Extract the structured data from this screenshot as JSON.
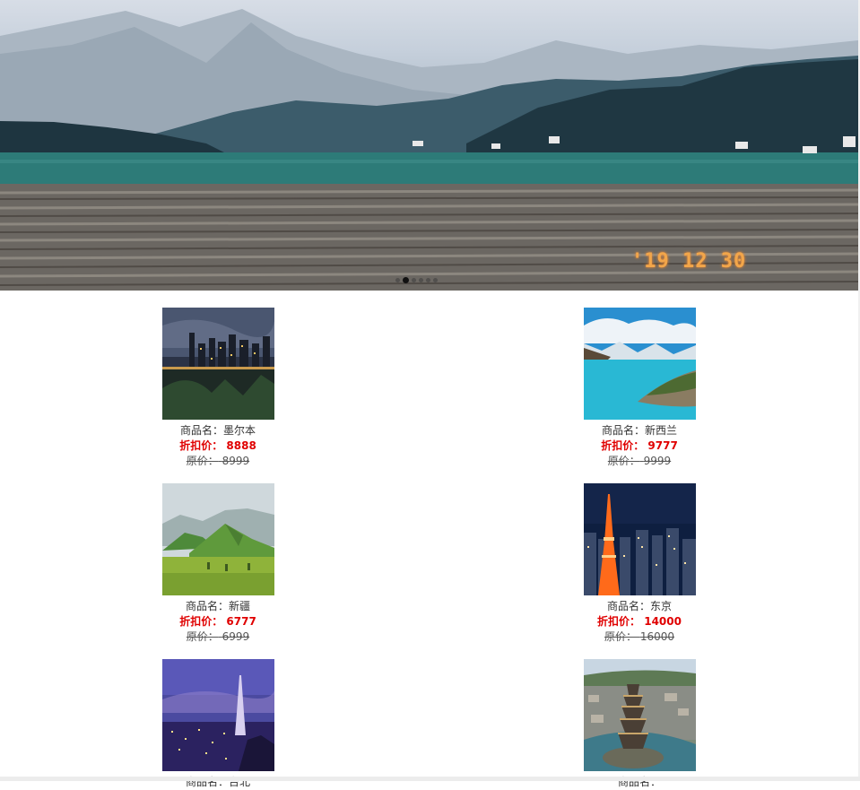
{
  "banner": {
    "date_stamp": "'19 12 30",
    "slide_count": 6,
    "active_slide": 1
  },
  "labels": {
    "name_prefix": "商品名：",
    "discount_prefix": "折扣价：",
    "orig_prefix": "原价："
  },
  "products": [
    {
      "name": "墨尔本",
      "discount": "8888",
      "orig": "8999",
      "image": "melbourne-skyline-photo"
    },
    {
      "name": "新西兰",
      "discount": "9777",
      "orig": "9999",
      "image": "new-zealand-lake-photo"
    },
    {
      "name": "新疆",
      "discount": "6777",
      "orig": "6999",
      "image": "xinjiang-grassland-photo"
    },
    {
      "name": "东京",
      "discount": "14000",
      "orig": "16000",
      "image": "tokyo-tower-night-photo"
    },
    {
      "name": "台北",
      "discount": "",
      "orig": "",
      "image": "taipei-101-night-photo"
    },
    {
      "name": "",
      "discount": "",
      "orig": "",
      "image": "pagoda-aerial-photo"
    }
  ]
}
